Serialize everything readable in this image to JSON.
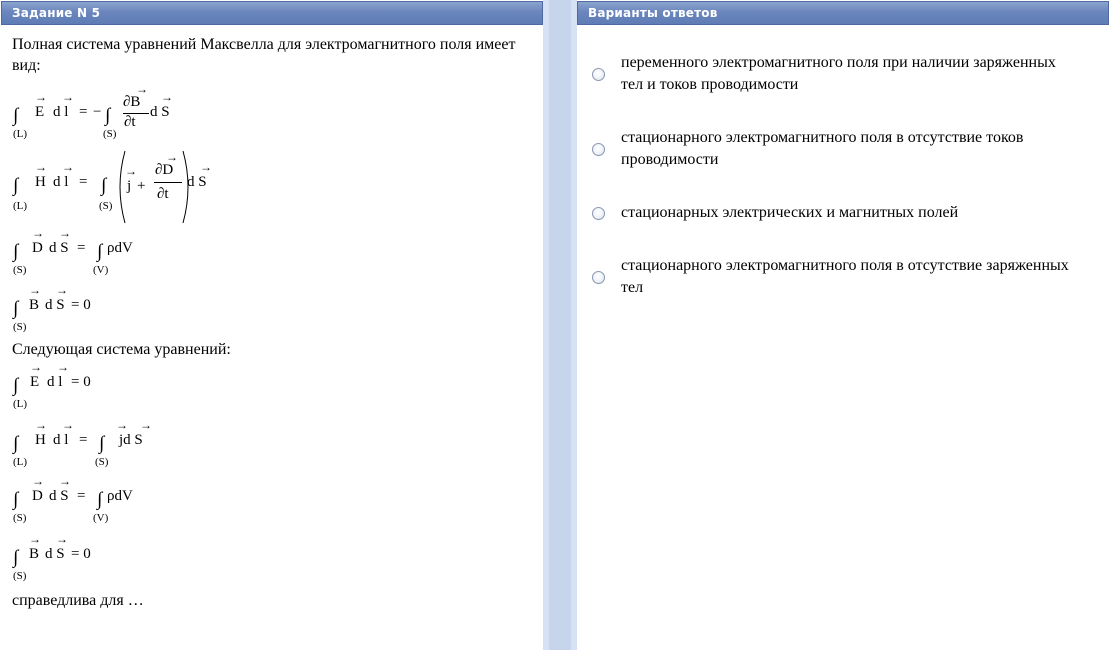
{
  "header": {
    "left_title": "Задание N 5",
    "right_title": "Варианты ответов"
  },
  "question": {
    "intro": "Полная система уравнений Максвелла для электромагнитного поля имеет вид:",
    "middle": "Следующая система уравнений:",
    "end": "справедлива для …"
  },
  "formulas": {
    "int": "∫",
    "eq": "=",
    "zero": "= 0",
    "minus": "−",
    "plus": "+",
    "L": "(L)",
    "S": "(S)",
    "V": "(V)",
    "E": "E",
    "H": "H",
    "D": "D",
    "B": "B",
    "dl": "d l",
    "dS": "d S",
    "dV": "ρdV",
    "j": "j",
    "jdS": "jd S",
    "dB": "∂B",
    "dD": "∂D",
    "dt": "∂t",
    "arrow": "→"
  },
  "answers": [
    {
      "text": "переменного электромагнитного поля при наличии заряженных тел и токов проводимости"
    },
    {
      "text": "стационарного  электромагнитного поля в отсутствие токов проводимости"
    },
    {
      "text": "стационарных электрических и магнитных полей"
    },
    {
      "text": "стационарного электромагнитного поля в отсутствие заряженных тел"
    }
  ]
}
